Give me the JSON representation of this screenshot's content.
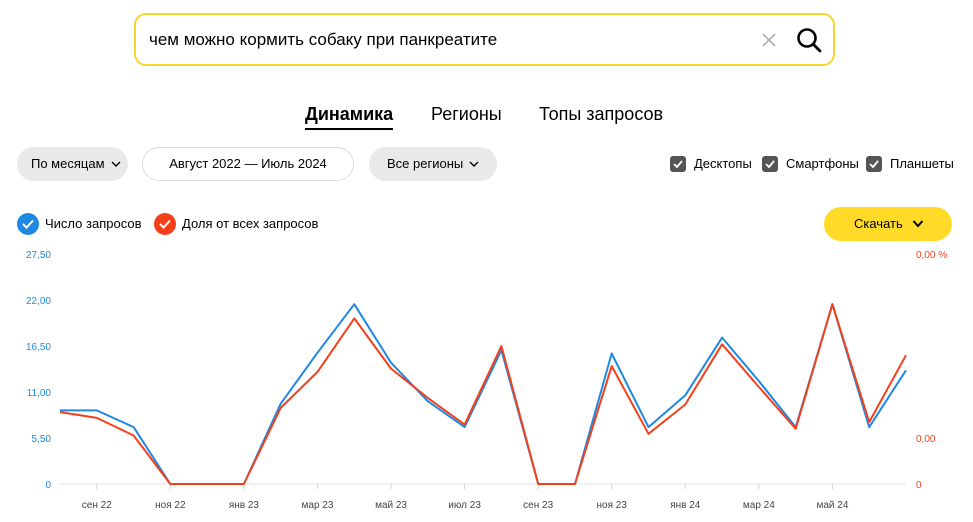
{
  "search": {
    "query": "чем можно кормить собаку при панкреатите"
  },
  "tabs": [
    {
      "label": "Динамика",
      "active": true
    },
    {
      "label": "Регионы",
      "active": false
    },
    {
      "label": "Топы запросов",
      "active": false
    }
  ],
  "filters": {
    "period_label": "По месяцам",
    "range_label": "Август 2022 — Июль 2024",
    "region_label": "Все регионы"
  },
  "devices": [
    {
      "label": "Десктопы",
      "checked": true
    },
    {
      "label": "Смартфоны",
      "checked": true
    },
    {
      "label": "Планшеты",
      "checked": true
    }
  ],
  "legend": [
    {
      "label": "Число запросов",
      "color": "#1e88e5",
      "icon": "check-icon"
    },
    {
      "label": "Доля от всех запросов",
      "color": "#f4401a",
      "icon": "check-icon"
    }
  ],
  "download_label": "Скачать",
  "colors": {
    "accent": "#f5d52e",
    "button": "#ffdb27",
    "series_count": "#1e88e5",
    "series_share": "#f4401a"
  },
  "chart_data": {
    "type": "line",
    "x": [
      "авг 22",
      "сен 22",
      "окт 22",
      "ноя 22",
      "дек 22",
      "янв 23",
      "фев 23",
      "мар 23",
      "апр 23",
      "май 23",
      "июн 23",
      "июл 23",
      "авг 23",
      "сен 23",
      "окт 23",
      "ноя 23",
      "дек 23",
      "янв 24",
      "фев 24",
      "мар 24",
      "апр 24",
      "май 24",
      "июн 24",
      "июл 24"
    ],
    "x_tick_labels": [
      "сен 22",
      "ноя 22",
      "янв 23",
      "мар 23",
      "май 23",
      "июл 23",
      "сен 23",
      "ноя 23",
      "янв 24",
      "мар 24",
      "май 24"
    ],
    "y_left_ticks": [
      "0",
      "5,50",
      "11,00",
      "16,50",
      "22,00",
      "27,50"
    ],
    "y_left_lim": [
      0,
      27.5
    ],
    "y_right_ticks": [
      "0",
      "0,00",
      "0,00 %"
    ],
    "series": [
      {
        "name": "Число запросов",
        "axis": "left",
        "color": "#1e88e5",
        "values": [
          8.8,
          8.8,
          6.8,
          0,
          0,
          0,
          9.6,
          15.7,
          21.5,
          14.5,
          9.9,
          6.8,
          16.0,
          0,
          0,
          15.6,
          6.8,
          10.6,
          17.5,
          12.3,
          6.8,
          21.5,
          6.8,
          13.6
        ]
      },
      {
        "name": "Доля от всех запросов",
        "axis": "right",
        "color": "#f4401a",
        "values": [
          8.6,
          7.9,
          5.8,
          0,
          0,
          0,
          9.1,
          13.4,
          19.8,
          13.8,
          10.3,
          7.1,
          16.5,
          0,
          0,
          14.1,
          6.0,
          9.5,
          16.7,
          11.6,
          6.6,
          21.5,
          7.4,
          15.4
        ]
      }
    ],
    "grid": false
  }
}
